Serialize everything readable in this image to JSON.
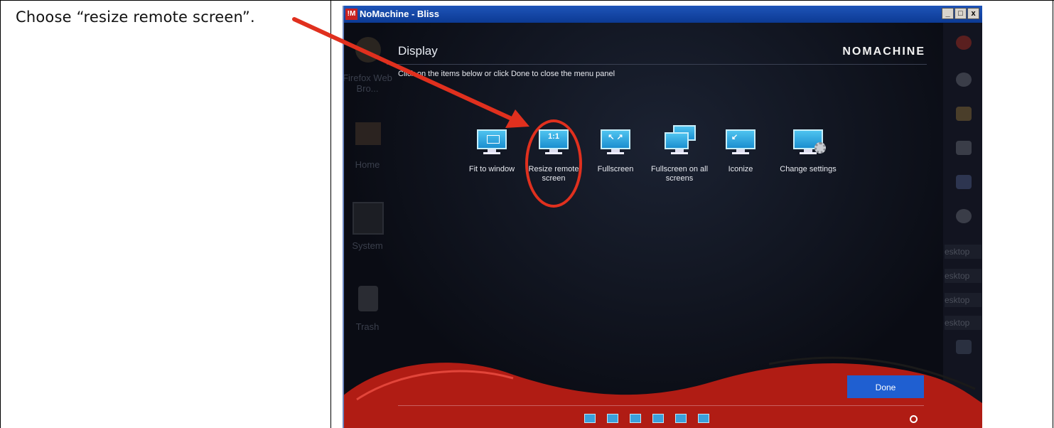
{
  "instruction": "Choose “resize remote screen”.",
  "window": {
    "title": "NoMachine - Bliss",
    "app_icon": "!M",
    "buttons": {
      "minimize": "_",
      "maximize": "□",
      "close": "x"
    }
  },
  "desktop": {
    "left_icons": [
      "Firefox Web Bro...",
      "Home",
      "System",
      "Trash"
    ],
    "right_labels": [
      "esktop",
      "esktop",
      "esktop",
      "esktop"
    ]
  },
  "panel": {
    "title": "Display",
    "brand": "NOMACHINE",
    "hint": "Click on the items below or click Done to close the menu panel",
    "items": [
      {
        "label": "Fit to window",
        "icon": "fit-to-window-icon",
        "glyph": ""
      },
      {
        "label": "Resize remote screen",
        "icon": "resize-remote-screen-icon",
        "glyph": "1:1"
      },
      {
        "label": "Fullscreen",
        "icon": "fullscreen-icon",
        "glyph": "↖ ↗"
      },
      {
        "label": "Fullscreen on all screens",
        "icon": "fullscreen-all-screens-icon",
        "glyph": ""
      },
      {
        "label": "Iconize",
        "icon": "iconize-icon",
        "glyph": "↙"
      },
      {
        "label": "Change settings",
        "icon": "change-settings-icon",
        "glyph": ""
      }
    ],
    "done_label": "Done"
  },
  "colors": {
    "annotation_red": "#e0301e",
    "done_blue": "#1f5fd1",
    "wave_red": "#b01c14"
  }
}
